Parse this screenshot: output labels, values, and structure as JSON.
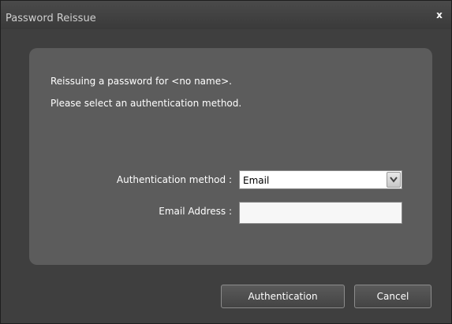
{
  "window": {
    "title": "Password Reissue",
    "close_label": "x"
  },
  "message": {
    "line1": "Reissuing a password for <no name>.",
    "line2": "Please select an authentication method."
  },
  "form": {
    "method_label": "Authentication method :",
    "method_value": "Email",
    "method_icon": "chevron-down-icon",
    "email_label": "Email Address :",
    "email_value": ""
  },
  "buttons": {
    "authentication": "Authentication",
    "cancel": "Cancel"
  },
  "colors": {
    "window_bg": "#3f3f3f",
    "panel_bg": "#5c5c5c",
    "text": "#ffffff"
  }
}
